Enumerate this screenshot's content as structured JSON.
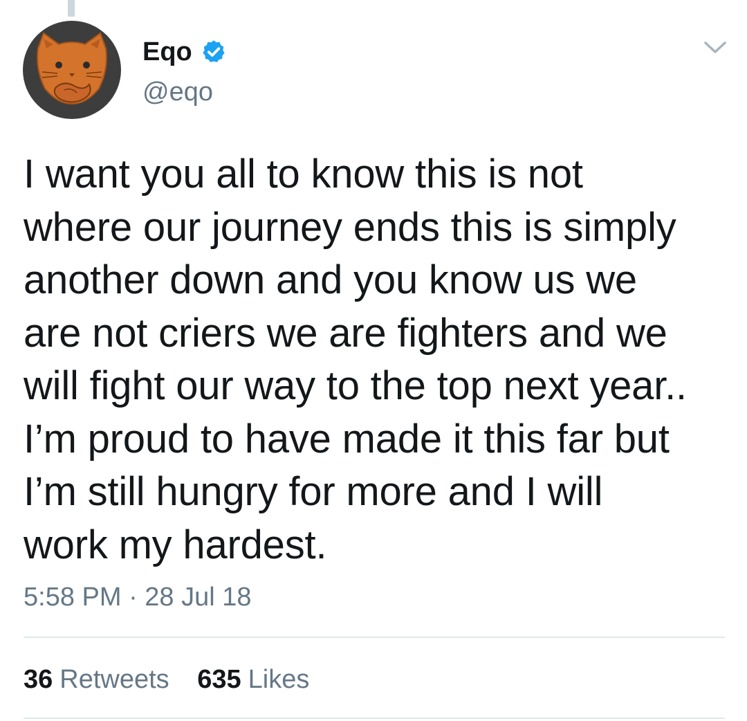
{
  "tweet": {
    "author": {
      "display_name": "Eqo",
      "handle": "@eqo",
      "verified": true,
      "avatar_icon": "orange-cat-face-icon"
    },
    "text": "I want you all to know this is not\nwhere our journey ends this is simply\nanother down and you know us we\nare not criers we are fighters and we\nwill fight our way to the top next year..\nI’m proud to have made it this far but\nI’m still hungry for more and I will\nwork my hardest.",
    "timestamp": "5:58 PM · 28 Jul 18",
    "stats": {
      "retweets_count": "36",
      "retweets_label": "Retweets",
      "likes_count": "635",
      "likes_label": "Likes"
    }
  },
  "colors": {
    "verified_blue": "#1da1f2",
    "secondary_text": "#657786",
    "avatar_background": "#3d3d3d",
    "avatar_cat": "#d4732b"
  }
}
